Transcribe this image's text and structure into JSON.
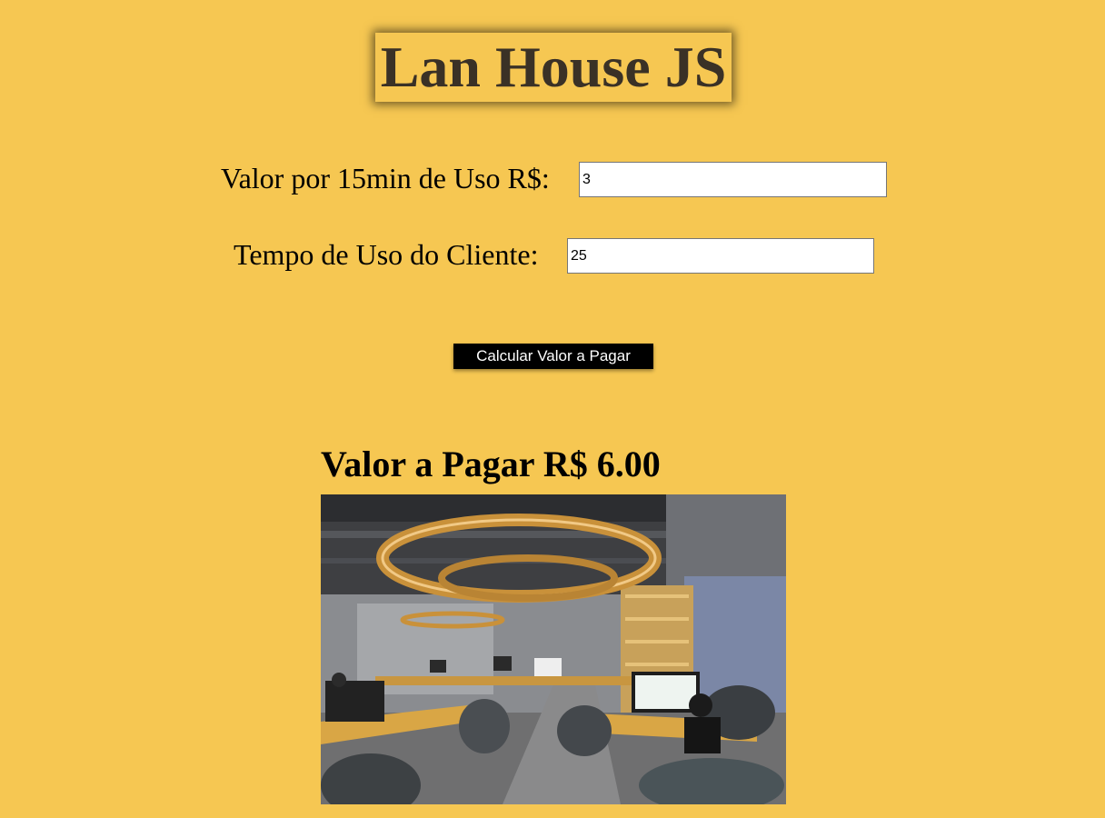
{
  "header": {
    "title": "Lan House JS"
  },
  "form": {
    "rate_label": "Valor por 15min de Uso R$:",
    "rate_value": "3",
    "time_label": "Tempo de Uso do Cliente:",
    "time_value": "25",
    "calculate_label": "Calcular Valor a Pagar"
  },
  "result": {
    "prefix": "Valor a Pagar R$",
    "amount": "6.00"
  },
  "photo": {
    "subject": "lan-house-interior-photo"
  }
}
